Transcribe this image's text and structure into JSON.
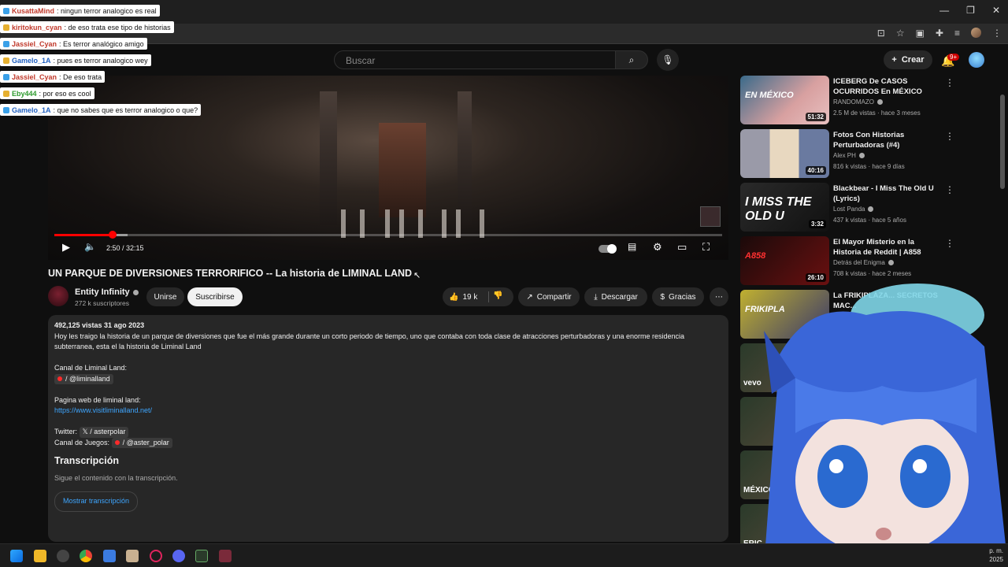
{
  "chat": [
    {
      "user": "KusattaMind",
      "text": ": ningun terror analogico es real",
      "color": "#c0392b"
    },
    {
      "user": "kiritokun_cyan",
      "text": ": de eso trata ese tipo de historias",
      "color": "#c0392b"
    },
    {
      "user": "Jassiel_Cyan",
      "text": ": Es terror analógico amigo",
      "color": "#c0392b"
    },
    {
      "user": "Gamelo_1A",
      "text": ": pues es terror analogico wey",
      "color": "#1f5fbf"
    },
    {
      "user": "Jassiel_Cyan",
      "text": ": De eso trata",
      "color": "#c0392b"
    },
    {
      "user": "Eby444",
      "text": ": por eso es cool",
      "color": "#2e9a2e"
    },
    {
      "user": "Gamelo_1A",
      "text": ": que no sabes que es terror analogico o que?",
      "color": "#1f5fbf"
    }
  ],
  "header": {
    "search_placeholder": "Buscar",
    "create_label": "Crear",
    "notif_count": "9+"
  },
  "player": {
    "time": "2:50 / 32:15",
    "progress_played": 0.087,
    "progress_buffered": 0.11
  },
  "video": {
    "title": "UN PARQUE DE DIVERSIONES TERRORIFICO -- La historia de LIMINAL LAND",
    "channel": "Entity Infinity",
    "subscribers": "272 k suscriptores",
    "join_label": "Unirse",
    "subscribe_label": "Suscribirse",
    "likes": "19 k",
    "share_label": "Compartir",
    "download_label": "Descargar",
    "thanks_label": "Gracias"
  },
  "description": {
    "meta": "492,125 vistas  31 ago 2023",
    "body": "Hoy les traigo la historia de un parque de diversiones que fue el más grande durante un corto periodo de tiempo, uno que contaba con toda clase de atracciones perturbadoras y una enorme residencia subterranea, esta el la historia de Liminal Land",
    "channel_label": "Canal de Liminal Land:",
    "channel_handle": "/ @liminalland",
    "web_label": "Pagina web de liminal land:",
    "web_url": "https://www.visitliminalland.net/",
    "twitter_label": "Twitter:",
    "twitter_handle": "/ asterpolar",
    "games_label": "Canal de Juegos:",
    "games_handle": "/ @aster_polar",
    "transcript_heading": "Transcripción",
    "transcript_sub": "Sigue el contenido con la transcripción.",
    "transcript_button": "Mostrar transcripción"
  },
  "sidebar": [
    {
      "title": "ICEBERG De CASOS OCURRIDOS En MÉXICO",
      "channel": "RANDOMAZO",
      "views": "2.5 M de vistas · hace 3 meses",
      "duration": "51:32",
      "thumb_text": "EN MÉXICO"
    },
    {
      "title": "Fotos Con Historias Perturbadoras (#4)",
      "channel": "Alex PH",
      "views": "816 k vistas · hace 9 días",
      "duration": "40:16",
      "thumb_text": ""
    },
    {
      "title": "Blackbear - I Miss The Old U (Lyrics)",
      "channel": "Lost Panda",
      "views": "437 k vistas · hace 5 años",
      "duration": "3:32",
      "thumb_text": "I MISS THE OLD U"
    },
    {
      "title": "El Mayor Misterio en la Historia de Reddit | A858",
      "channel": "Detrás del Enigma",
      "views": "708 k vistas · hace 2 meses",
      "duration": "26:10",
      "thumb_text": "A858"
    },
    {
      "title": "La FRIKIPLAZA... SECRETOS MAC...",
      "channel": "Lo Q...",
      "views": "",
      "duration": "",
      "thumb_text": "FRIKIPLA"
    }
  ],
  "sidebar_extra_thumbs": [
    "vevo",
    "",
    "MÉXICO",
    "ERIC"
  ],
  "taskbar": {
    "clock_line1": "p. m.",
    "clock_line2": "2025"
  }
}
